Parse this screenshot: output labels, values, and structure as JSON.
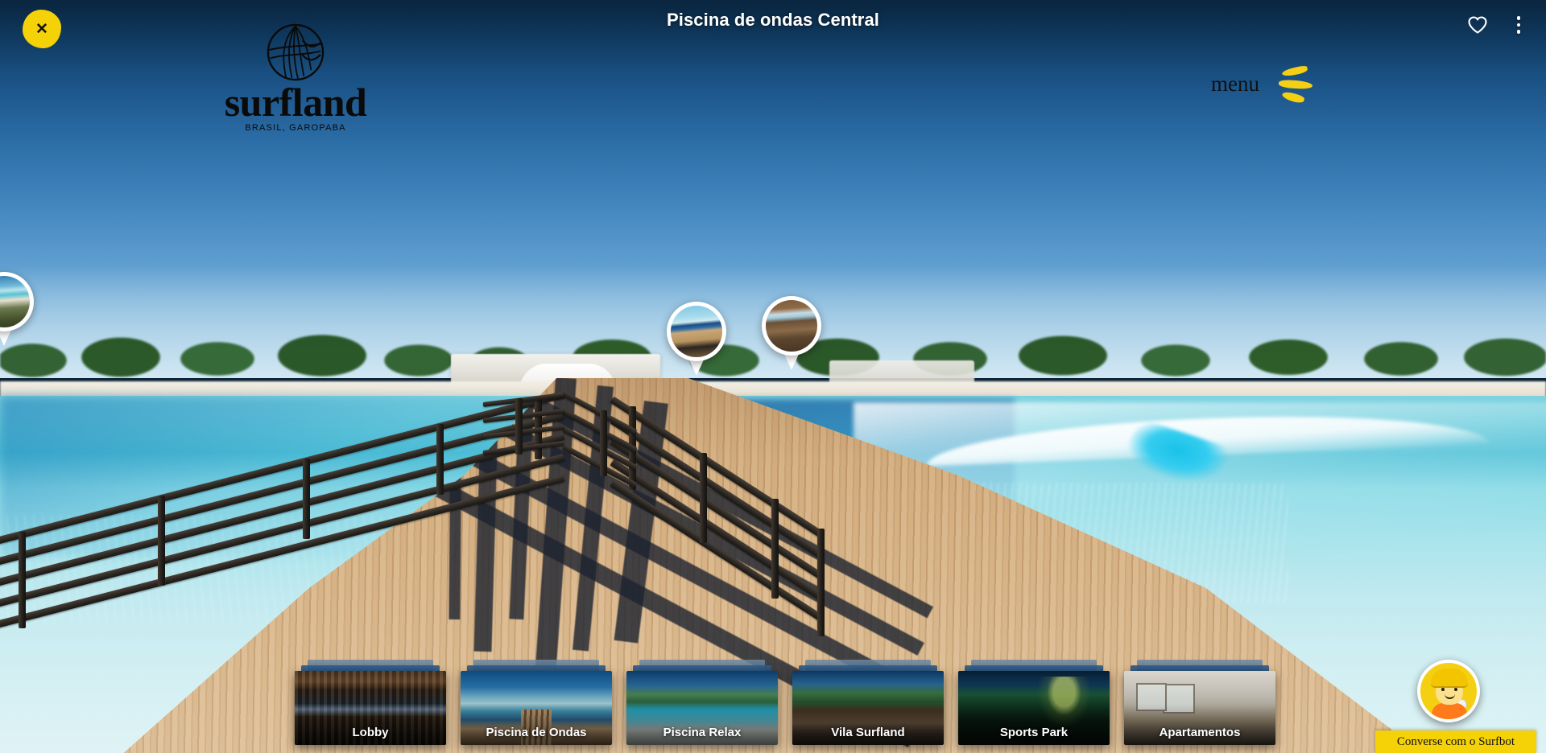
{
  "header": {
    "title": "Piscina de ondas Central",
    "close_label": "✕",
    "favorite_icon": "heart-icon",
    "more_icon": "kebab-menu-icon"
  },
  "brand": {
    "wordmark": "surfland",
    "tagline": "BRASIL, GAROPABA",
    "mark_icon": "leaf-globe-icon"
  },
  "menu": {
    "label": "menu",
    "icon": "brush-hamburger-icon"
  },
  "hotspots": [
    {
      "name": "hotspot-left-edge",
      "scene": "thumb-beach"
    },
    {
      "name": "hotspot-boardwalk",
      "scene": "thumb-boardwalk"
    },
    {
      "name": "hotspot-deckchairs",
      "scene": "thumb-deckchairs"
    }
  ],
  "thumbnails": [
    {
      "label": "Lobby",
      "scene": "sc-lobby"
    },
    {
      "label": "Piscina de Ondas",
      "scene": "sc-ondas"
    },
    {
      "label": "Piscina Relax",
      "scene": "sc-relax"
    },
    {
      "label": "Vila Surfland",
      "scene": "sc-vila"
    },
    {
      "label": "Sports Park",
      "scene": "sc-sports"
    },
    {
      "label": "Apartamentos",
      "scene": "sc-apto"
    }
  ],
  "surfbot": {
    "label": "Converse com o Surfbot",
    "avatar_icon": "surfer-avatar-icon"
  },
  "colors": {
    "accent_yellow": "#f5d108",
    "menu_yellow": "#f5cf12",
    "sky_top": "#0c2f50",
    "water_turquoise": "#7fd3e0",
    "deck_wood": "#d2ac7e"
  }
}
